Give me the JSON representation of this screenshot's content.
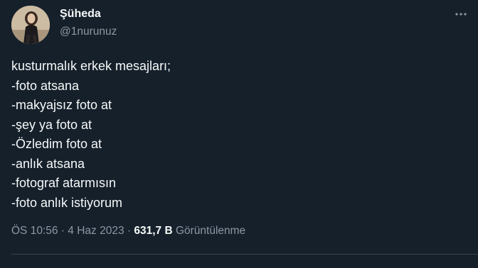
{
  "author": {
    "display_name": "Şüheda",
    "handle": "@1nurunuz"
  },
  "tweet": {
    "lines": [
      "kusturmalık erkek mesajları;",
      "-foto atsana",
      "-makyajsız foto at",
      "-şey ya foto at",
      "-Özledim foto at",
      "-anlık atsana",
      "-fotograf atarmısın",
      "-foto anlık istiyorum"
    ]
  },
  "meta": {
    "time": "ÖS 10:56",
    "separator": " · ",
    "date": "4 Haz 2023",
    "views_count": "631,7 B",
    "views_label": "Görüntülenme"
  },
  "icons": {
    "more": "more-horizontal-icon",
    "avatar": "profile-photo"
  },
  "colors": {
    "background": "#15202b",
    "primary_text": "#f7f9f9",
    "secondary_text": "#8b98a5",
    "divider": "#38444d"
  }
}
